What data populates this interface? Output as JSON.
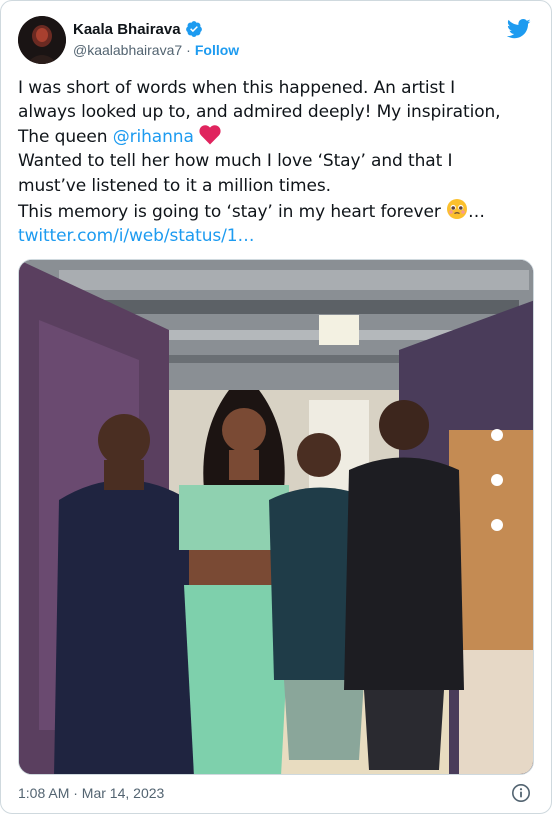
{
  "author": {
    "name": "Kaala Bhairava",
    "handle": "@kaalabhairava7",
    "separator": "·",
    "follow_label": "Follow",
    "avatar_icon": "avatar-photo",
    "verified_icon": "verified-badge-icon"
  },
  "brand": {
    "logo_icon": "twitter-bird-icon",
    "color": "#1d9bf0"
  },
  "tweet": {
    "line1": "I was short of words when this happened. An artist I",
    "line2": "always looked up to, and admired deeply! My inspiration,",
    "line3_prefix": "The queen ",
    "mention": "@rihanna",
    "line4": "Wanted to tell her how much I love ‘Stay’ and that I",
    "line5": "must’ve listened to it a million times.",
    "line6": "This memory is going to ‘stay’ in my heart forever ",
    "line6_suffix": "…",
    "link": "twitter.com/i/web/status/1…"
  },
  "photo": {
    "description_icon": "photo-image"
  },
  "footer": {
    "timestamp": "1:08 AM · Mar 14, 2023",
    "info_icon": "info-icon"
  },
  "colors": {
    "text": "#0f1419",
    "secondary": "#536471",
    "link": "#1d9bf0",
    "border": "#cfd9de",
    "heart": "#f91880"
  }
}
